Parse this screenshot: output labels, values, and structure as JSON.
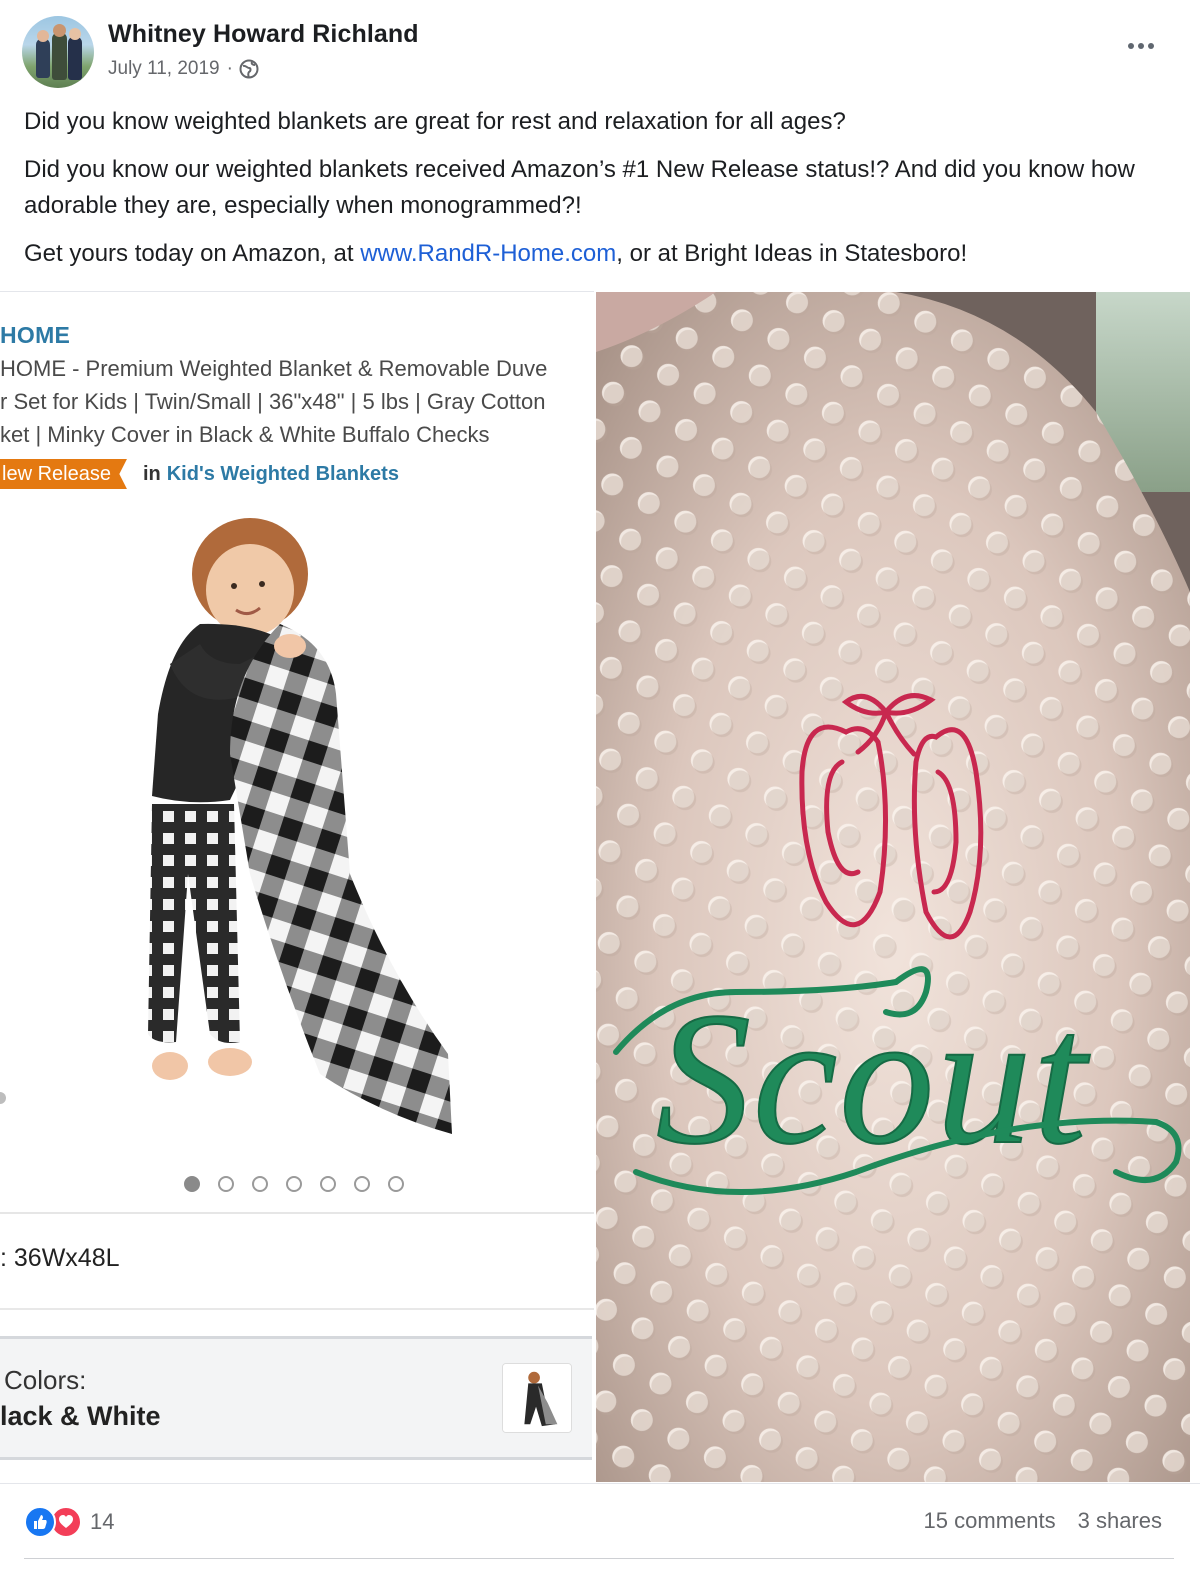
{
  "post": {
    "author": "Whitney Howard Richland",
    "date": "July 11, 2019",
    "meta_separator": "·",
    "privacy_icon": "globe-icon",
    "paragraph1": "Did you know weighted blankets are great for rest and relaxation for all ages?",
    "paragraph2": "Did you know our weighted blankets received Amazon’s #1 New Release status!? And did you know how adorable they are, especially when monogrammed?!",
    "paragraph3_before": "Get yours today on Amazon, at ",
    "paragraph3_link": "www.RandR-Home.com",
    "paragraph3_after": ", or at Bright Ideas in Statesboro!"
  },
  "amazon_screenshot": {
    "brand": "HOME",
    "title_line1": "HOME - Premium Weighted Blanket & Removable Duve",
    "title_line2": "r Set for Kids | Twin/Small | 36\"x48\" | 5 lbs | Gray Cotton",
    "title_line3": "ket | Minky Cover in Black & White Buffalo Checks",
    "badge": "lew Release",
    "badge_in": "in",
    "badge_category": "Kid's Weighted Blankets",
    "carousel_count": 7,
    "carousel_active": 0,
    "size_value": ": 36Wx48L",
    "colors_label": "Colors:",
    "colors_value": "lack & White"
  },
  "photo": {
    "embroidered_text": "Scout"
  },
  "footer": {
    "reaction_count": "14",
    "comments": "15 comments",
    "shares": "3 shares"
  },
  "colors": {
    "link": "#1d5fd6",
    "amazon_badge": "#e47911",
    "amazon_link": "#2d7aa5",
    "like_blue": "#1877f2",
    "love_red": "#f33e58",
    "embroidery_green": "#1f8a5a",
    "embroidery_pink": "#c8284f"
  }
}
